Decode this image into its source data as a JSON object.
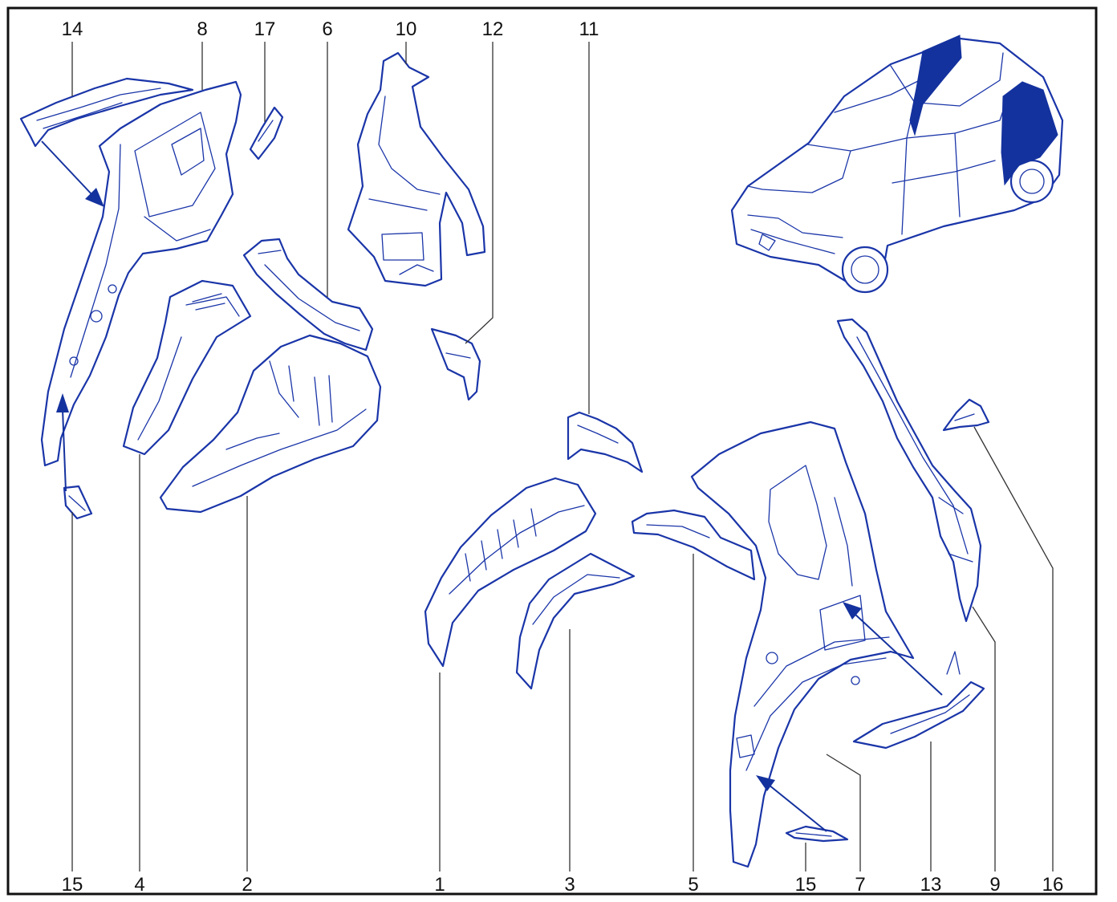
{
  "diagram": {
    "callouts_top": [
      {
        "id": "c14",
        "text": "14"
      },
      {
        "id": "c8",
        "text": "8"
      },
      {
        "id": "c17",
        "text": "17"
      },
      {
        "id": "c6",
        "text": "6"
      },
      {
        "id": "c10",
        "text": "10"
      },
      {
        "id": "c12",
        "text": "12"
      },
      {
        "id": "c11",
        "text": "11"
      }
    ],
    "callouts_bottom": [
      {
        "id": "c15a",
        "text": "15"
      },
      {
        "id": "c4",
        "text": "4"
      },
      {
        "id": "c2",
        "text": "2"
      },
      {
        "id": "c1",
        "text": "1"
      },
      {
        "id": "c3",
        "text": "3"
      },
      {
        "id": "c5",
        "text": "5"
      },
      {
        "id": "c15b",
        "text": "15"
      },
      {
        "id": "c7",
        "text": "7"
      },
      {
        "id": "c13",
        "text": "13"
      },
      {
        "id": "c9",
        "text": "9"
      },
      {
        "id": "c16",
        "text": "16"
      }
    ],
    "colors": {
      "line_art": "#1a35a8",
      "highlight_fill": "#14329e",
      "frame": "#111111"
    }
  }
}
